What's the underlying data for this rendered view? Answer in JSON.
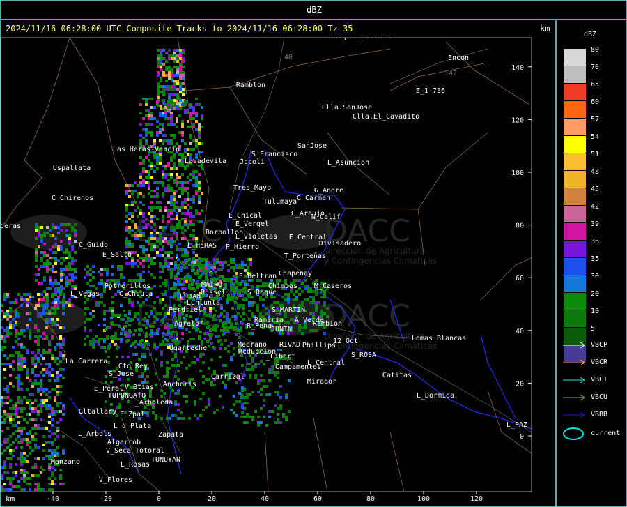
{
  "header": {
    "title": "dBZ"
  },
  "map": {
    "subtitle": "2024/11/16 06:28:00 UTC Composite Tracks to 2024/11/16 06:28:00 Tz 35",
    "unit_top": "km",
    "unit_bottom": "km",
    "x_ticks": [
      "-40",
      "-20",
      "0",
      "20",
      "40",
      "60",
      "80",
      "100",
      "120"
    ],
    "y_ticks": [
      "140",
      "120",
      "100",
      "80",
      "60",
      "40",
      "20",
      "0"
    ],
    "places": [
      {
        "name": "Ramblon"
      },
      {
        "name": "Encon"
      },
      {
        "name": "E_1-736"
      },
      {
        "name": "Clla.SanJose"
      },
      {
        "name": "Clla.El_Cavadito"
      },
      {
        "name": "S_Francisco"
      },
      {
        "name": "SanJose"
      },
      {
        "name": "Jccoli"
      },
      {
        "name": "L_Asuncion"
      },
      {
        "name": "Uspallata"
      },
      {
        "name": "Las_Heras-Vencio"
      },
      {
        "name": "Lavadevila"
      },
      {
        "name": "Tres_Mayo"
      },
      {
        "name": "G_Andre"
      },
      {
        "name": "Tulumaya"
      },
      {
        "name": "C_Carmen"
      },
      {
        "name": "C_Chirenos"
      },
      {
        "name": "E_Chical"
      },
      {
        "name": "C_Araujo"
      },
      {
        "name": "E_Vergel"
      },
      {
        "name": "N_Calif"
      },
      {
        "name": "Borbollon"
      },
      {
        "name": "L_Violetas"
      },
      {
        "name": "E_Central"
      },
      {
        "name": "Divisadero"
      },
      {
        "name": "C_Guido"
      },
      {
        "name": "L_HERAS"
      },
      {
        "name": "P_Hierro"
      },
      {
        "name": "E_Salto"
      },
      {
        "name": "T_Porteñas"
      },
      {
        "name": "Chapenay"
      },
      {
        "name": "E_Beltran"
      },
      {
        "name": "Potrerillos"
      },
      {
        "name": "MAIPU"
      },
      {
        "name": "Chimbas"
      },
      {
        "name": "M_Caseros"
      },
      {
        "name": "L_Vegas"
      },
      {
        "name": "C_Chcuta"
      },
      {
        "name": "Russel"
      },
      {
        "name": "S_Roque"
      },
      {
        "name": "LUJAN"
      },
      {
        "name": "Lunlunta"
      },
      {
        "name": "S_MARTIN"
      },
      {
        "name": "Perdriel"
      },
      {
        "name": "Ramiria"
      },
      {
        "name": "A_Verde"
      },
      {
        "name": "Agrelo"
      },
      {
        "name": "R_Pena"
      },
      {
        "name": "JUNIN"
      },
      {
        "name": "Rambion"
      },
      {
        "name": "Ugarteche"
      },
      {
        "name": "Medrano"
      },
      {
        "name": "RIVAD"
      },
      {
        "name": "Phillips"
      },
      {
        "name": "12_Oct"
      },
      {
        "name": "Lomas_Blancas"
      },
      {
        "name": "La_Carrera"
      },
      {
        "name": "Reduccion"
      },
      {
        "name": "L_Libert"
      },
      {
        "name": "S_ROSA"
      },
      {
        "name": "Cto_Rey"
      },
      {
        "name": "Campamentos"
      },
      {
        "name": "L_Central"
      },
      {
        "name": "S_Jose"
      },
      {
        "name": "Carrizal"
      },
      {
        "name": "Catitas"
      },
      {
        "name": "E_Peral"
      },
      {
        "name": "V_Btias"
      },
      {
        "name": "Anchoris"
      },
      {
        "name": "Mirador"
      },
      {
        "name": "TUPUNGATO"
      },
      {
        "name": "L_Dormida"
      },
      {
        "name": "L_Arboleda"
      },
      {
        "name": "Gltallary"
      },
      {
        "name": "E_Zpal"
      },
      {
        "name": "L_d_Plata"
      },
      {
        "name": "L_PAZ"
      },
      {
        "name": "L_Arbols"
      },
      {
        "name": "Zapata"
      },
      {
        "name": "Algarrob"
      },
      {
        "name": "TUNUYAN"
      },
      {
        "name": "V_Seca"
      },
      {
        "name": "Totoral"
      },
      {
        "name": "Manzano"
      },
      {
        "name": "L_Rosas"
      },
      {
        "name": "V_Flores"
      },
      {
        "name": "aderas"
      },
      {
        "name": "Chaquel_Rosario"
      }
    ],
    "road_numbers": [
      "40",
      "142"
    ],
    "watermark": {
      "brand": "DACC",
      "line1": "Dirección de Agricultura",
      "line2": "y Contingencias Climáticas"
    }
  },
  "legend": {
    "title": "dBZ",
    "levels": [
      {
        "value": "80",
        "color": "#d8d8d8"
      },
      {
        "value": "70",
        "color": "#bdbdbd"
      },
      {
        "value": "65",
        "color": "#f03c28"
      },
      {
        "value": "60",
        "color": "#ff6410"
      },
      {
        "value": "57",
        "color": "#ff9a64"
      },
      {
        "value": "54",
        "color": "#ffff00"
      },
      {
        "value": "51",
        "color": "#f8c030"
      },
      {
        "value": "48",
        "color": "#f0b428"
      },
      {
        "value": "45",
        "color": "#d2823c"
      },
      {
        "value": "42",
        "color": "#c86496"
      },
      {
        "value": "39",
        "color": "#d214a0"
      },
      {
        "value": "36",
        "color": "#7814dc"
      },
      {
        "value": "35",
        "color": "#1e50f0"
      },
      {
        "value": "30",
        "color": "#1478d8"
      },
      {
        "value": "20",
        "color": "#0a8c0a"
      },
      {
        "value": "10",
        "color": "#0a780a"
      },
      {
        "value": "5",
        "color": "#0a5a0a"
      },
      {
        "value": "",
        "color": "#463c96"
      }
    ],
    "tracks": [
      {
        "label": "VBCP",
        "color": "#ffffff"
      },
      {
        "label": "VBCR",
        "color": "#ffaa82"
      },
      {
        "label": "VBCT",
        "color": "#00e6e6"
      },
      {
        "label": "VBCU",
        "color": "#32dc32"
      },
      {
        "label": "VBBB",
        "color": "#1e1ec8"
      }
    ],
    "current": {
      "label": "current",
      "color": "#00e6e6"
    }
  }
}
